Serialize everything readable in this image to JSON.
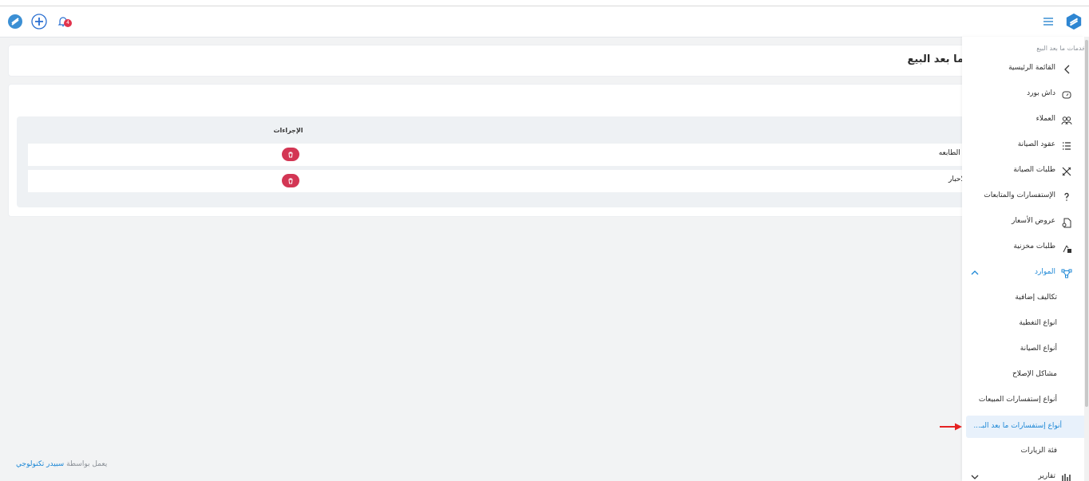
{
  "header": {
    "notification_count": "4"
  },
  "page": {
    "title": "ما بعد البيع"
  },
  "table": {
    "actions_header": "الإجراءات",
    "rows": [
      {
        "name": "ع الطابعه"
      },
      {
        "name": "الاحبار"
      }
    ]
  },
  "footer": {
    "prefix": "يعمل بواسطة",
    "brand": "سبيدر تكنولوجي"
  },
  "sidebar": {
    "section": "خدمات ما بعد البيع",
    "items": [
      {
        "label": "القائمة الرئيسية",
        "icon": "chevron-left-icon"
      },
      {
        "label": "داش بورد",
        "icon": "gauge-icon"
      },
      {
        "label": "العملاء",
        "icon": "users-icon"
      },
      {
        "label": "عقود الصيانة",
        "icon": "list-icon"
      },
      {
        "label": "طلبات الصيانة",
        "icon": "tools-icon"
      },
      {
        "label": "الإستفسارات والمتابعات",
        "icon": "question-icon"
      },
      {
        "label": "عروض الأسعار",
        "icon": "document-icon"
      },
      {
        "label": "طلبات مخزنية",
        "icon": "warehouse-icon"
      },
      {
        "label": "الموارد",
        "icon": "nodes-icon"
      }
    ],
    "subitems": [
      {
        "label": "تكاليف إضافية"
      },
      {
        "label": "انواع التغطية"
      },
      {
        "label": "أنواع الصيانة"
      },
      {
        "label": "مشاكل الإصلاح"
      },
      {
        "label": "أنواع إستفسارات المبيعات"
      },
      {
        "label": "أنواع إستفسارات ما بعد البـ..."
      },
      {
        "label": "فئة الزيارات"
      }
    ],
    "reports": {
      "label": "تقارير",
      "icon": "bar-chart-icon"
    }
  },
  "colors": {
    "accent": "#1c87d6",
    "danger": "#d33654",
    "active_bg": "#e8f1fb"
  }
}
